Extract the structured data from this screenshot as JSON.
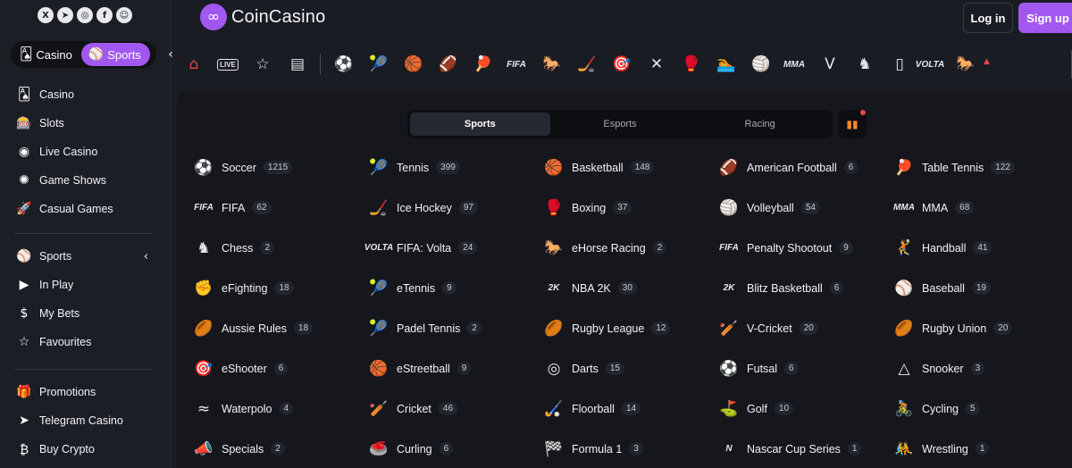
{
  "header": {
    "brand": "CoinCasino",
    "login_label": "Log in",
    "signup_label": "Sign up"
  },
  "sidebar": {
    "toggle": {
      "casino_label": "Casino",
      "sports_label": "Sports"
    },
    "group1": [
      {
        "label": "Casino",
        "icon": "cards-icon"
      },
      {
        "label": "Slots",
        "icon": "slot-machine-icon"
      },
      {
        "label": "Live Casino",
        "icon": "chip-icon"
      },
      {
        "label": "Game Shows",
        "icon": "star-burst-icon"
      },
      {
        "label": "Casual Games",
        "icon": "rocket-icon"
      }
    ],
    "group2": [
      {
        "label": "Sports",
        "icon": "sports-icon"
      },
      {
        "label": "In Play",
        "icon": "play-icon"
      },
      {
        "label": "My Bets",
        "icon": "coin-icon"
      },
      {
        "label": "Favourites",
        "icon": "star-icon"
      }
    ],
    "group3": [
      {
        "label": "Promotions",
        "icon": "gift-icon"
      },
      {
        "label": "Telegram Casino",
        "icon": "telegram-icon"
      },
      {
        "label": "Buy Crypto",
        "icon": "bitcoin-icon"
      }
    ]
  },
  "iconbar": {
    "live_label": "LIVE",
    "fifa_label": "FIFA",
    "mma_label": "MMA",
    "volta_label": "VOLTA"
  },
  "tabs": [
    "Sports",
    "Esports",
    "Racing"
  ],
  "sports": [
    {
      "name": "Soccer",
      "count": "1215",
      "icon": "⚽"
    },
    {
      "name": "Tennis",
      "count": "399",
      "icon": "🎾"
    },
    {
      "name": "Basketball",
      "count": "148",
      "icon": "🏀"
    },
    {
      "name": "American Football",
      "count": "6",
      "icon": "🏈"
    },
    {
      "name": "Table Tennis",
      "count": "122",
      "icon": "🏓"
    },
    {
      "name": "FIFA",
      "count": "62",
      "icon": "FIFA"
    },
    {
      "name": "Ice Hockey",
      "count": "97",
      "icon": "🏒"
    },
    {
      "name": "Boxing",
      "count": "37",
      "icon": "🥊"
    },
    {
      "name": "Volleyball",
      "count": "54",
      "icon": "🏐"
    },
    {
      "name": "MMA",
      "count": "68",
      "icon": "MMA"
    },
    {
      "name": "Chess",
      "count": "2",
      "icon": "♞"
    },
    {
      "name": "FIFA: Volta",
      "count": "24",
      "icon": "VOLTA"
    },
    {
      "name": "eHorse Racing",
      "count": "2",
      "icon": "🐎"
    },
    {
      "name": "Penalty Shootout",
      "count": "9",
      "icon": "FIFA"
    },
    {
      "name": "Handball",
      "count": "41",
      "icon": "🤾"
    },
    {
      "name": "eFighting",
      "count": "18",
      "icon": "✊"
    },
    {
      "name": "eTennis",
      "count": "9",
      "icon": "🎾"
    },
    {
      "name": "NBA 2K",
      "count": "30",
      "icon": "2K"
    },
    {
      "name": "Blitz Basketball",
      "count": "6",
      "icon": "2K"
    },
    {
      "name": "Baseball",
      "count": "19",
      "icon": "⚾"
    },
    {
      "name": "Aussie Rules",
      "count": "18",
      "icon": "🏉"
    },
    {
      "name": "Padel Tennis",
      "count": "2",
      "icon": "🎾"
    },
    {
      "name": "Rugby League",
      "count": "12",
      "icon": "🏉"
    },
    {
      "name": "V-Cricket",
      "count": "20",
      "icon": "🏏"
    },
    {
      "name": "Rugby Union",
      "count": "20",
      "icon": "🏉"
    },
    {
      "name": "eShooter",
      "count": "6",
      "icon": "🎯"
    },
    {
      "name": "eStreetball",
      "count": "9",
      "icon": "🏀"
    },
    {
      "name": "Darts",
      "count": "15",
      "icon": "◎"
    },
    {
      "name": "Futsal",
      "count": "6",
      "icon": "⚽"
    },
    {
      "name": "Snooker",
      "count": "3",
      "icon": "△"
    },
    {
      "name": "Waterpolo",
      "count": "4",
      "icon": "≈"
    },
    {
      "name": "Cricket",
      "count": "46",
      "icon": "🏏"
    },
    {
      "name": "Floorball",
      "count": "14",
      "icon": "🏑"
    },
    {
      "name": "Golf",
      "count": "10",
      "icon": "⛳"
    },
    {
      "name": "Cycling",
      "count": "5",
      "icon": "🚴"
    },
    {
      "name": "Specials",
      "count": "2",
      "icon": "📣"
    },
    {
      "name": "Curling",
      "count": "6",
      "icon": "🥌"
    },
    {
      "name": "Formula 1",
      "count": "3",
      "icon": "🏁"
    },
    {
      "name": "Nascar Cup Series",
      "count": "1",
      "icon": "N"
    },
    {
      "name": "Wrestling",
      "count": "1",
      "icon": "🤼"
    }
  ]
}
